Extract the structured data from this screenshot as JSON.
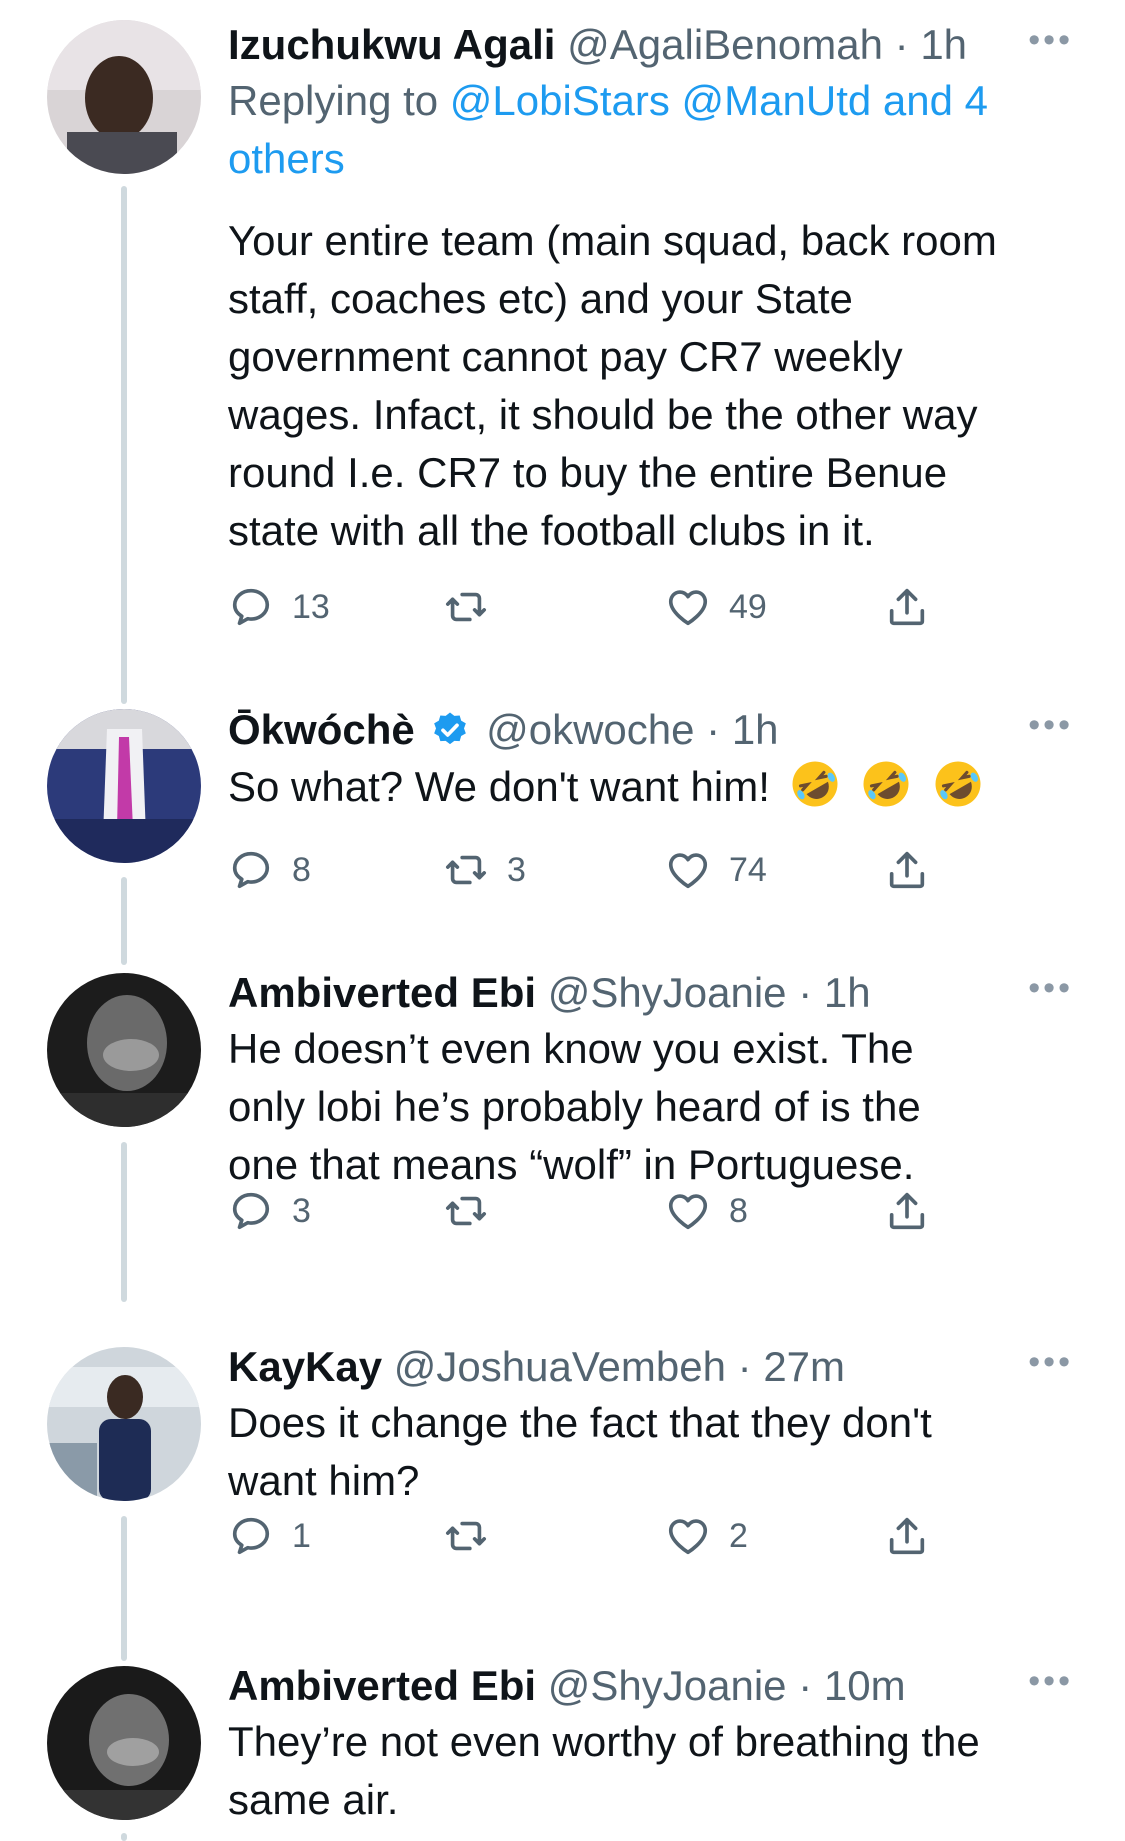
{
  "thread": [
    {
      "name": "Izuchukwu Agali",
      "handle": "@AgaliBenomah",
      "time": "1h",
      "replying_prefix": "Replying to",
      "replying_links": "@LobiStars @ManUtd and 4",
      "replying_links_2": "others",
      "lines": [
        "Your entire team (main squad, back room",
        "staff, coaches etc) and your State",
        "government cannot pay CR7 weekly",
        "wages. Infact, it should be the other way",
        "round I.e. CR7 to buy the entire Benue",
        "state with all the football clubs in it."
      ],
      "replies": "13",
      "retweets": "",
      "likes": "49"
    },
    {
      "name": "Ōkwóchè",
      "handle": "@okwoche",
      "time": "1h",
      "verified": true,
      "lines": [
        "So what? We don't want him!"
      ],
      "emoji": [
        "rolling-on-floor-laughing",
        "rolling-on-floor-laughing",
        "rolling-on-floor-laughing"
      ],
      "replies": "8",
      "retweets": "3",
      "likes": "74"
    },
    {
      "name": "Ambiverted Ebi",
      "handle": "@ShyJoanie",
      "time": "1h",
      "lines": [
        "He doesn’t even know you exist. The",
        "only lobi he’s probably heard of is the",
        "one that means “wolf” in Portuguese."
      ],
      "replies": "3",
      "retweets": "",
      "likes": "8"
    },
    {
      "name": "KayKay",
      "handle": "@JoshuaVembeh",
      "time": "27m",
      "lines": [
        "Does it change the fact that they don't",
        "want him?"
      ],
      "replies": "1",
      "retweets": "",
      "likes": "2"
    },
    {
      "name": "Ambiverted Ebi",
      "handle": "@ShyJoanie",
      "time": "10m",
      "lines": [
        "They’re not even worthy of breathing the",
        "same air."
      ]
    }
  ],
  "separator": "·",
  "more_label": "•••",
  "colors": {
    "accent": "#1d9bf0",
    "muted": "#536471",
    "text": "#0f1419",
    "line": "#cfd9de"
  }
}
